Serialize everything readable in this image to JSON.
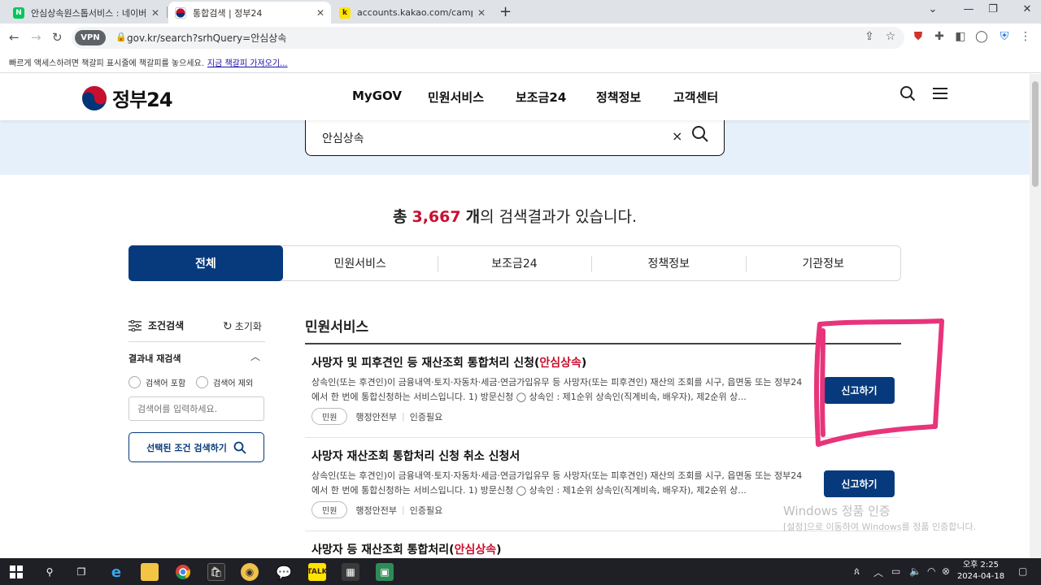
{
  "browser": {
    "tabs": [
      {
        "title": "안심상속원스톱서비스 : 네이버",
        "favicon": "N",
        "favicon_color": "#03c75a"
      },
      {
        "title": "통합검색 | 정부24",
        "favicon": "",
        "favicon_color": "#003478"
      },
      {
        "title": "accounts.kakao.com/campaigns",
        "favicon": "k",
        "favicon_color": "#fee500"
      }
    ],
    "new_tab": "+",
    "vpn_badge": "VPN",
    "url": "gov.kr/search?srhQuery=안심상속",
    "bookmarks_hint": "빠르게 액세스하려면 책갈피 표시줄에 책갈피를 놓으세요.",
    "bookmarks_link": "지금 책갈피 가져오기..."
  },
  "site": {
    "logo": "정부24",
    "nav": [
      "MyGOV",
      "민원서비스",
      "보조금24",
      "정책정보",
      "고객센터"
    ]
  },
  "search": {
    "query": "안심상속",
    "clear": "×"
  },
  "result_summary": {
    "prefix": "총",
    "count": "3,667",
    "unit": "개",
    "suffix": "의 검색결과가 있습니다."
  },
  "categories": [
    "전체",
    "민원서비스",
    "보조금24",
    "정책정보",
    "기관정보"
  ],
  "filter": {
    "title": "조건검색",
    "reset": "초기화",
    "refine_title": "결과내 재검색",
    "include": "검색어 포함",
    "exclude": "검색어 제외",
    "placeholder": "검색어를 입력하세요.",
    "apply": "선택된 조건 검색하기"
  },
  "section": {
    "title": "민원서비스"
  },
  "results": [
    {
      "title_main": "사망자 및 피후견인 등 재산조회 통합처리 신청(",
      "title_hl": "안심상속",
      "title_end": ")",
      "desc": "상속인(또는 후견인)이 금융내역·토지·자동차·세금·연금가입유무 등 사망자(또는 피후견인) 재산의 조회를 시구, 읍면동 또는 정부24에서 한 번에 통합신청하는 서비스입니다. 1) 방문신청 ◯ 상속인 : 제1순위 상속인(직계비속, 배우자), 제2순위 상...",
      "chip": "민원",
      "agency": "행정안전부",
      "auth": "인증필요",
      "action": "신고하기"
    },
    {
      "title_main": "사망자 재산조회 통합처리 신청 취소 신청서",
      "title_hl": "",
      "title_end": "",
      "desc": "상속인(또는 후견인)이 금융내역·토지·자동차·세금·연금가입유무 등 사망자(또는 피후견인) 재산의 조회를 시구, 읍면동 또는 정부24에서 한 번에 통합신청하는 서비스입니다. 1) 방문신청 ◯ 상속인 : 제1순위 상속인(직계비속, 배우자), 제2순위 상...",
      "chip": "민원",
      "agency": "행정안전부",
      "auth": "인증필요",
      "action": "신고하기"
    },
    {
      "title_main": "사망자 등 재산조회 통합처리(",
      "title_hl": "안심상속",
      "title_end": ")"
    }
  ],
  "watermark": {
    "line1": "Windows 정품 인증",
    "line2": "[설정]으로 이동하여 Windows를 정품 인증합니다."
  },
  "taskbar": {
    "time": "오후 2:25",
    "date": "2024-04-18"
  },
  "colors": {
    "brand_navy": "#063a7c",
    "highlight_red": "#c8102e",
    "annotation_pink": "#e8347a",
    "search_band": "#e5f0fb"
  }
}
